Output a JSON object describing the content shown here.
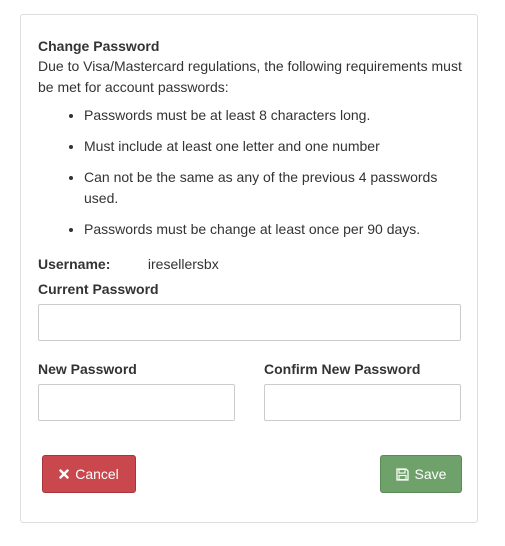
{
  "form": {
    "title": "Change Password",
    "intro": "Due to Visa/Mastercard regulations, the following requirements must be met for account passwords:",
    "requirements": [
      "Passwords must be at least 8 characters long.",
      "Must include at least one letter and one number",
      "Can not be the same as any of the previous 4 passwords used.",
      "Passwords must be change at least once per 90 days."
    ],
    "username_label": "Username:",
    "username_value": "iresellersbx",
    "current_password_label": "Current Password",
    "current_password_value": "",
    "new_password_label": "New Password",
    "new_password_value": "",
    "confirm_password_label": "Confirm New Password",
    "confirm_password_value": ""
  },
  "buttons": {
    "cancel_label": "Cancel",
    "cancel_icon": "close-icon",
    "cancel_color": "#c9484e",
    "save_label": "Save",
    "save_icon": "floppy-disk-icon",
    "save_color": "#6ea26a"
  }
}
